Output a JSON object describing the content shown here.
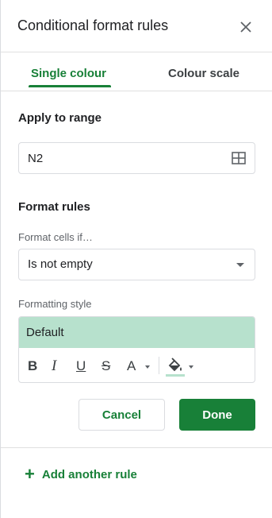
{
  "header": {
    "title": "Conditional format rules"
  },
  "tabs": [
    {
      "label": "Single colour"
    },
    {
      "label": "Colour scale"
    }
  ],
  "range": {
    "label": "Apply to range",
    "value": "N2"
  },
  "format_rules": {
    "label": "Format rules",
    "condition_label": "Format cells if…",
    "condition_value": "Is not empty"
  },
  "formatting_style": {
    "label": "Formatting style",
    "preview_text": "Default",
    "preview_color": "#b7e1cd",
    "toolbar": {
      "bold": "B",
      "italic": "I",
      "underline": "U",
      "strikethrough": "S",
      "text_color": "A"
    }
  },
  "buttons": {
    "cancel": "Cancel",
    "done": "Done"
  },
  "add_rule": {
    "label": "Add another rule"
  },
  "colors": {
    "accent": "#188038"
  }
}
